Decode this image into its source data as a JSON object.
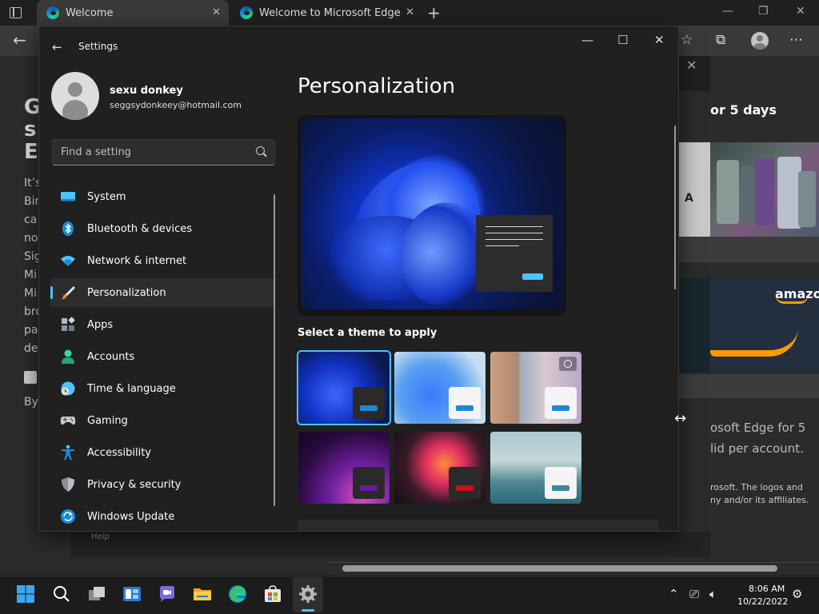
{
  "browser": {
    "tabs": [
      {
        "label": "Welcome"
      },
      {
        "label": "Welcome to Microsoft Edge"
      }
    ],
    "new_tab_symbol": "+",
    "close_symbol": "✕",
    "back_symbol": "←"
  },
  "page": {
    "left_fragments": [
      "G",
      "s",
      "E"
    ],
    "left_text_lines": [
      "It’s",
      "Bir",
      "ca",
      "no",
      "Sig",
      "Mi",
      "Mi",
      "bro",
      "pa",
      "de"
    ],
    "by_fragment": "By"
  },
  "promo": {
    "heading": "or 5 days",
    "amazon": "amazon",
    "letter": "A",
    "body_lines": [
      "osoft Edge for 5",
      "lid per account."
    ],
    "legal_lines": [
      "rosoft. The logos and",
      "ny and/or its affiliates."
    ],
    "close_symbol": "✕"
  },
  "help": "Help",
  "settings": {
    "title": "Settings",
    "back_symbol": "←",
    "controls": {
      "minimize": "—",
      "maximize": "☐",
      "close": "✕"
    },
    "user": {
      "name": "sexu donkey",
      "email": "seggsydonkeey@hotmail.com"
    },
    "search": {
      "placeholder": "Find a setting"
    },
    "nav": [
      {
        "label": "System",
        "icon": "system-icon"
      },
      {
        "label": "Bluetooth & devices",
        "icon": "bluetooth-icon"
      },
      {
        "label": "Network & internet",
        "icon": "wifi-icon"
      },
      {
        "label": "Personalization",
        "icon": "brush-icon",
        "selected": true
      },
      {
        "label": "Apps",
        "icon": "apps-icon"
      },
      {
        "label": "Accounts",
        "icon": "accounts-icon"
      },
      {
        "label": "Time & language",
        "icon": "clock-globe-icon"
      },
      {
        "label": "Gaming",
        "icon": "gamepad-icon"
      },
      {
        "label": "Accessibility",
        "icon": "accessibility-icon"
      },
      {
        "label": "Privacy & security",
        "icon": "shield-icon"
      },
      {
        "label": "Windows Update",
        "icon": "update-icon"
      }
    ],
    "content": {
      "title": "Personalization",
      "theme_heading": "Select a theme to apply",
      "themes": [
        {
          "name": "windows-dark",
          "selected": true
        },
        {
          "name": "windows-light"
        },
        {
          "name": "spotlight"
        },
        {
          "name": "glow"
        },
        {
          "name": "captured-motion"
        },
        {
          "name": "flow"
        }
      ]
    }
  },
  "taskbar": {
    "time": "8:06 AM",
    "date": "10/22/2022",
    "apps": [
      "start-icon",
      "search-icon",
      "task-view-icon",
      "widgets-icon",
      "chat-icon",
      "file-explorer-icon",
      "edge-icon",
      "store-icon",
      "settings-icon"
    ]
  },
  "colors": {
    "accent": "#4cc2ff",
    "window_bg": "#202020",
    "selected_nav": "#2d2d2d"
  }
}
